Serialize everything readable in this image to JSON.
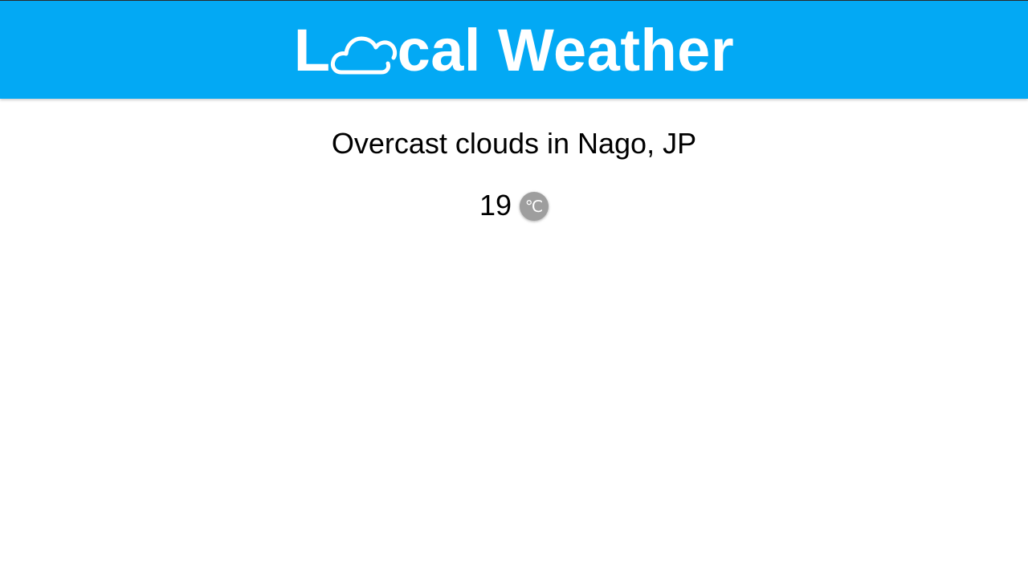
{
  "header": {
    "title_prefix": "L",
    "title_suffix": "cal Weather",
    "logo_icon": "cloud-icon",
    "background_color": "#03a9f4"
  },
  "weather": {
    "conditions": "Overcast clouds in Nago, JP",
    "temperature": "19",
    "unit_toggle_label": "℃",
    "unit_toggle_color": "#9e9e9e"
  }
}
